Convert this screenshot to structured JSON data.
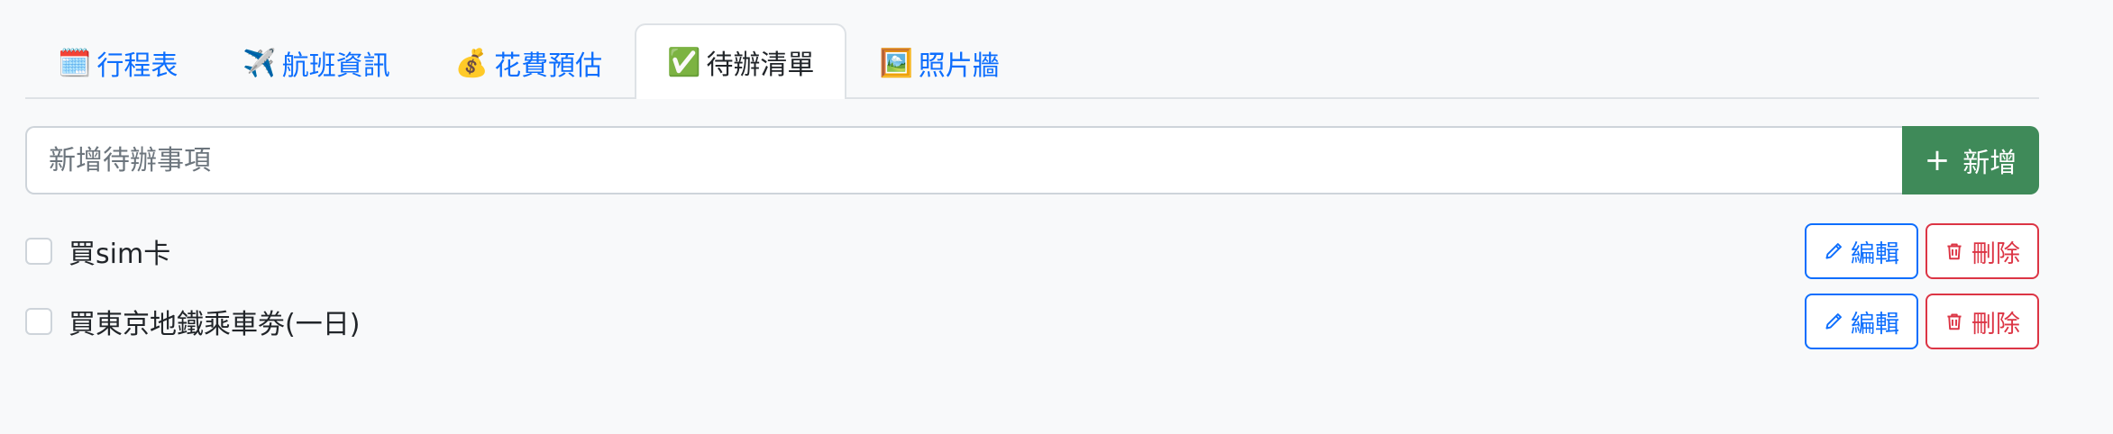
{
  "tabs": [
    {
      "emoji": "🗓️",
      "label": "行程表",
      "active": false,
      "icon": "calendar-icon"
    },
    {
      "emoji": "✈️",
      "label": "航班資訊",
      "active": false,
      "icon": "airplane-icon"
    },
    {
      "emoji": "💰",
      "label": "花費預估",
      "active": false,
      "icon": "money-bag-icon"
    },
    {
      "emoji": "✅",
      "label": "待辦清單",
      "active": true,
      "icon": "check-mark-icon"
    },
    {
      "emoji": "🖼️",
      "label": "照片牆",
      "active": false,
      "icon": "picture-icon"
    }
  ],
  "add": {
    "placeholder": "新增待辦事項",
    "value": "",
    "button_icon": "+",
    "button_label": "新增"
  },
  "todos": [
    {
      "text": "買sim卡",
      "checked": false,
      "edit_label": "編輯",
      "delete_label": "刪除"
    },
    {
      "text": "買東京地鐵乘車劵(一日)",
      "checked": false,
      "edit_label": "編輯",
      "delete_label": "刪除"
    }
  ],
  "colors": {
    "accent": "#0d6efd",
    "success": "#3f8a59",
    "danger": "#dc3545",
    "background": "#f8f9fa"
  }
}
